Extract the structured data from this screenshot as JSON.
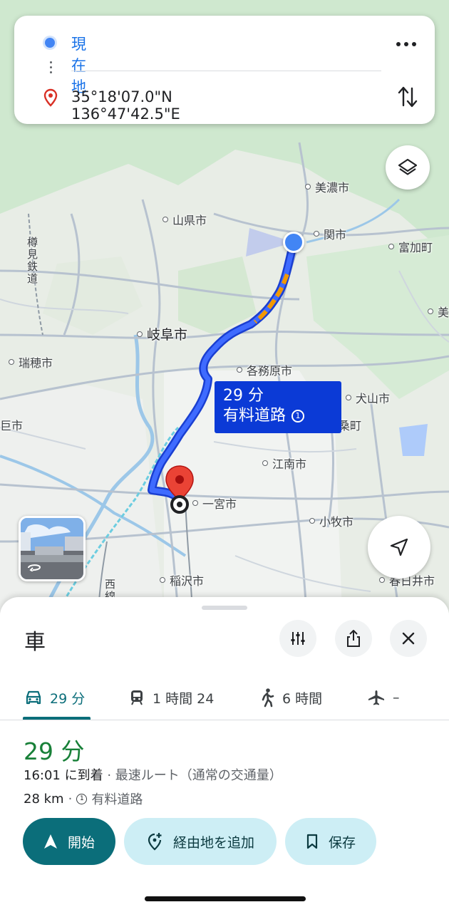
{
  "search": {
    "origin": "現在地",
    "destination": "35°18'07.0\"N 136°47'42.5\"E",
    "more_icon": "more-horizontal-icon",
    "swap_icon": "swap-vertical-icon"
  },
  "map": {
    "places": {
      "mino": "美濃市",
      "yamagata": "山県市",
      "seki": "関市",
      "tomika": "富加町",
      "mi": "美",
      "gifu": "岐阜市",
      "mizuho": "瑞穂市",
      "kakamigahara": "各務原市",
      "inuyama": "犬山市",
      "fusou": "桑町",
      "kounan": "江南市",
      "ichinomiya": "一宮市",
      "komaki": "小牧市",
      "inazawa": "稲沢市",
      "kasugai": "春日井市",
      "edge_left": "巨市"
    },
    "rail_tarumi": "樽見鉄道",
    "rail_west": "西線",
    "route_label": {
      "duration": "29 分",
      "toll": "有料道路"
    },
    "colors": {
      "route": "#1a4fe6",
      "traffic": "#f29900",
      "origin": "#4285f4",
      "destination": "#ea4335"
    }
  },
  "sheet": {
    "mode_title": "車",
    "tabs": [
      {
        "label": "29 分",
        "icon": "car-icon"
      },
      {
        "label": "1 時間 24",
        "icon": "train-icon"
      },
      {
        "label": "6 時間",
        "icon": "walk-icon"
      },
      {
        "label": "–",
        "icon": "flight-icon"
      }
    ],
    "duration": "29 分",
    "arrival": "16:01 に到着",
    "route_desc": " · 最速ルート（通常の交通量）",
    "distance": "28 km",
    "distance_sep": " ·",
    "toll": "有料道路",
    "buttons": {
      "start": "開始",
      "add_stop": "経由地を追加",
      "save": "保存"
    },
    "accent": "#0b6e7a"
  }
}
